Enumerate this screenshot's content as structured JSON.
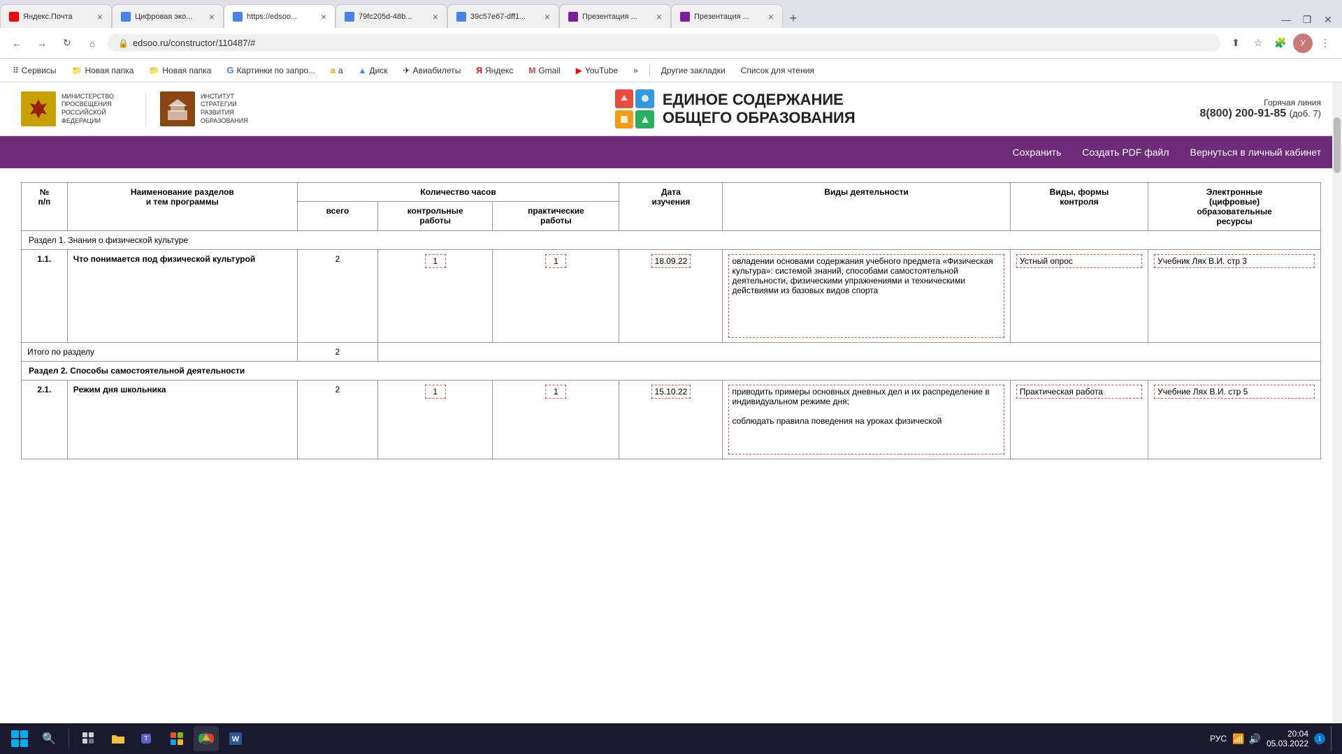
{
  "browser": {
    "tabs": [
      {
        "id": 1,
        "label": "Яндекс.Почта",
        "icon": "yandex",
        "active": false,
        "closable": true
      },
      {
        "id": 2,
        "label": "Цифровая эко...",
        "icon": "blue",
        "active": false,
        "closable": true
      },
      {
        "id": 3,
        "label": "https://edsoo...",
        "icon": "blue",
        "active": true,
        "closable": true
      },
      {
        "id": 4,
        "label": "79fc205d-48b...",
        "icon": "blue",
        "active": false,
        "closable": true
      },
      {
        "id": 5,
        "label": "39c57e67-dff1...",
        "icon": "blue",
        "active": false,
        "closable": true
      },
      {
        "id": 6,
        "label": "Презентация ...",
        "icon": "purple",
        "active": false,
        "closable": true
      },
      {
        "id": 7,
        "label": "Презентация ...",
        "icon": "purple",
        "active": false,
        "closable": true
      }
    ],
    "url": "edsoo.ru/constructor/110487/#",
    "bookmarks": [
      {
        "label": "Сервисы",
        "icon": "⠿"
      },
      {
        "label": "Новая папка",
        "icon": "📁"
      },
      {
        "label": "Новая папка",
        "icon": "📁"
      },
      {
        "label": "Картинки по запро...",
        "icon": "G"
      },
      {
        "label": "a",
        "icon": ""
      },
      {
        "label": "Диск",
        "icon": "▲"
      },
      {
        "label": "Авиабилеты",
        "icon": "✈"
      },
      {
        "label": "Яндекс",
        "icon": "Я"
      },
      {
        "label": "Gmail",
        "icon": "M"
      },
      {
        "label": "YouTube",
        "icon": "▶"
      }
    ],
    "more_bookmarks": "»",
    "other_bookmarks": "Другие закладки",
    "reading_list": "Список для чтения"
  },
  "site": {
    "ministry_label": "МИНИСТЕРСТВО ПРОСВЕЩЕНИЯ\nРОССИЙСКОЙ ФЕДЕРАЦИИ",
    "institute_label": "ИНСТИТУТ СТРАТЕГИИ\nРАЗВИТИЯ ОБРАЗОВАНИЯ",
    "title_line1": "ЕДИНОЕ СОДЕРЖАНИЕ",
    "title_line2": "ОБЩЕГО ОБРАЗОВАНИЯ",
    "hotline_label": "Горячая линия",
    "hotline_number": "8(800) 200-91-85",
    "hotline_ext": "(доб. 7)",
    "nav": {
      "save": "Сохранить",
      "pdf": "Создать PDF файл",
      "cabinet": "Вернуться в личный кабинет"
    }
  },
  "table": {
    "headers": {
      "no": "№\nп/п",
      "name": "Наименование разделов\nи тем программы",
      "hours_group": "Количество часов",
      "hours_total": "всего",
      "hours_control": "контрольные\nработы",
      "hours_practical": "практические\nработы",
      "date": "Дата\nизучения",
      "activity": "Виды деятельности",
      "control_types": "Виды, формы\nконтроля",
      "resources": "Электронные\n(цифровые)\nобразовательные\nресурсы"
    },
    "sections": [
      {
        "type": "section",
        "title": "Раздел 1. Знания о физической культуре"
      },
      {
        "type": "row",
        "no": "1.1.",
        "name": "Что понимается под физической культурой",
        "hours_total": "2",
        "hours_control": "1",
        "hours_practical": "1",
        "date": "18.09.22",
        "activity": "овладении основами содержания учебного предмета «Физическая культура»: системой знаний, способами самостоятельной деятельности, физическими упражнениями и техническими действиями из базовых видов спорта",
        "control_types": "Устный опрос",
        "resources": "Учебник Лях В.И. стр 3"
      },
      {
        "type": "total",
        "label": "Итого по разделу",
        "value": "2"
      },
      {
        "type": "section",
        "title": "Раздел 2. Способы самостоятельной деятельности",
        "bold": true
      },
      {
        "type": "row",
        "no": "2.1.",
        "name": "Режим дня школьника",
        "hours_total": "2",
        "hours_control": "1",
        "hours_practical": "1",
        "date": "15.10.22",
        "activity": "приводить примеры основных дневных дел и их распределение в индивидуальном режиме дня;\n\nсоблюдать правила поведения на уроках физической",
        "control_types": "Практическая работа",
        "resources": "Учебние Лях В.И. стр 5"
      }
    ]
  },
  "taskbar": {
    "time": "20:04",
    "date": "05.03.2022",
    "language": "РУС",
    "notification_count": "1"
  }
}
